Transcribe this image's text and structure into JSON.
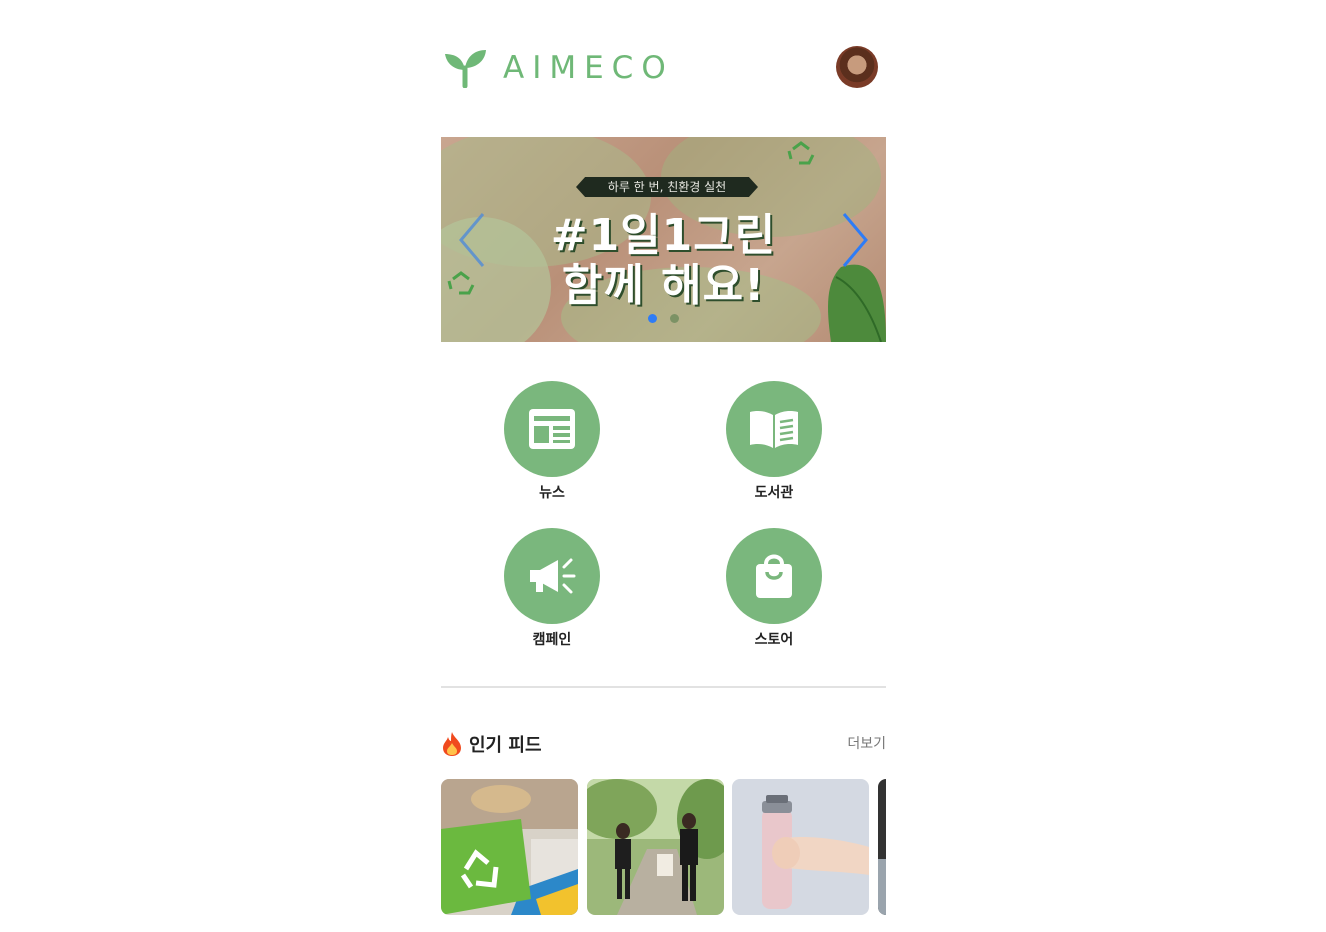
{
  "header": {
    "logo_text": "AIMECO",
    "logo_icon": "sprout-icon",
    "avatar_icon": "user-avatar"
  },
  "banner": {
    "tagline": "하루 한 번, 친환경 실천",
    "headline_line1": "#1일1그린",
    "headline_line2": "함께 해요!",
    "prev_icon": "chevron-left-icon",
    "next_icon": "chevron-right-icon",
    "slide_count": 2,
    "active_slide": 1
  },
  "menu": {
    "items": [
      {
        "label": "뉴스",
        "icon": "newspaper-icon"
      },
      {
        "label": "도서관",
        "icon": "open-book-icon"
      },
      {
        "label": "캠페인",
        "icon": "megaphone-icon"
      },
      {
        "label": "스토어",
        "icon": "shopping-bag-icon"
      }
    ]
  },
  "feed": {
    "title": "인기 피드",
    "title_icon": "fire-icon",
    "more_label": "더보기",
    "thumbnails": [
      "recycling-bin-photo",
      "hikers-photo",
      "tumbler-photo",
      "dark-photo-partial"
    ]
  },
  "colors": {
    "brand_green": "#7ab77d",
    "logo_green": "#6fb877",
    "active_dot": "#2e7cf6"
  }
}
